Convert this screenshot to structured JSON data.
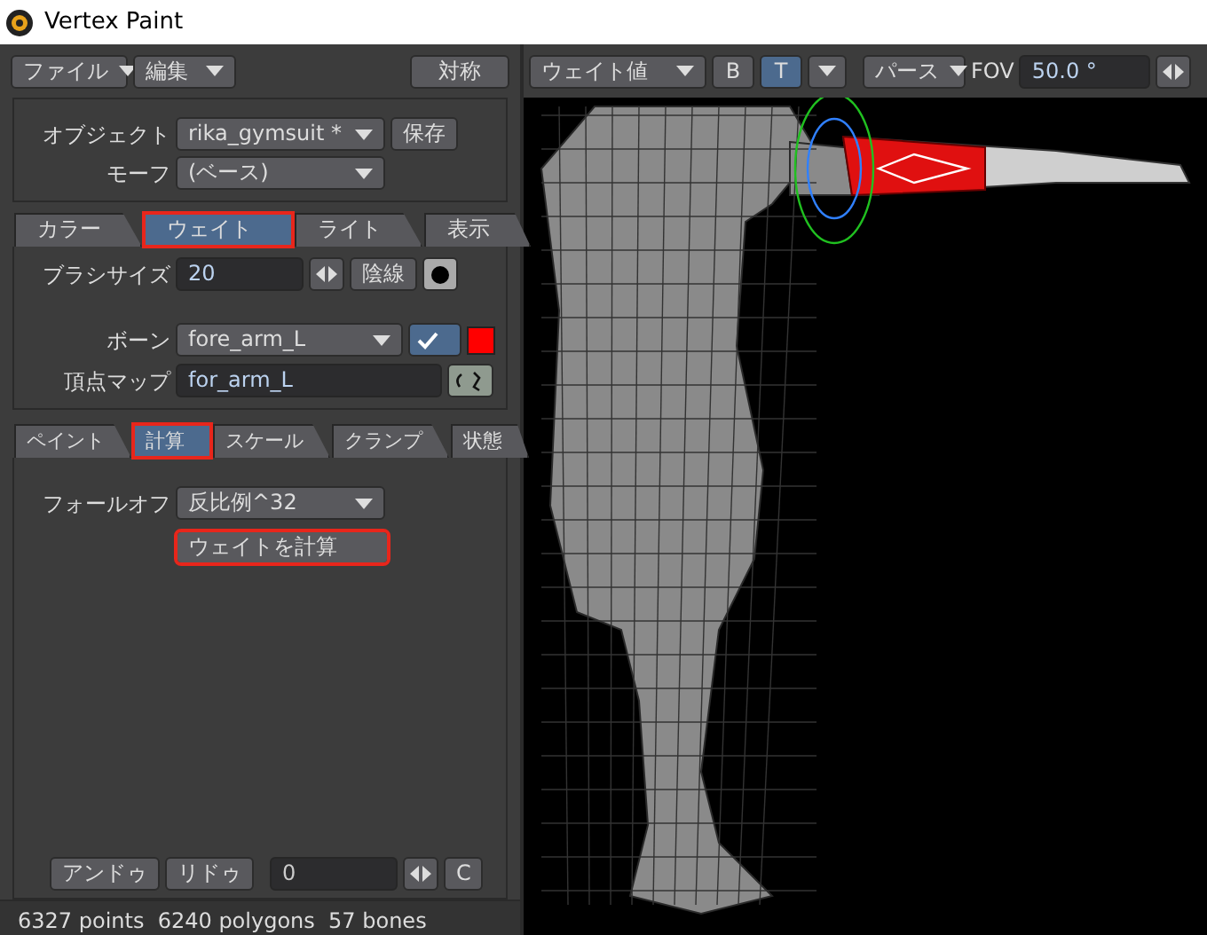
{
  "window": {
    "title": "Vertex Paint"
  },
  "menus": [
    {
      "label": "ファイル",
      "kind": "dropdown"
    },
    {
      "label": "編集",
      "kind": "dropdown"
    },
    {
      "label": "対称",
      "kind": "button"
    }
  ],
  "object_group": {
    "object_label": "オブジェクト",
    "object_value": "rika_gymsuit *",
    "save_button": "保存",
    "morph_label": "モーフ",
    "morph_value": "(ベース)"
  },
  "tabs": [
    {
      "label": "カラー",
      "selected": false,
      "highlighted": false
    },
    {
      "label": "ウェイト",
      "selected": true,
      "highlighted": true
    },
    {
      "label": "ライト",
      "selected": false,
      "highlighted": false
    },
    {
      "label": "表示",
      "selected": false,
      "highlighted": false
    }
  ],
  "brush": {
    "label": "ブラシサイズ",
    "value": "20",
    "hidden_line_button": "陰線"
  },
  "bone": {
    "label": "ボーン",
    "value": "fore_arm_L",
    "checked": true,
    "color": "#ff0000"
  },
  "vertex_map": {
    "label": "頂点マップ",
    "value": "for_arm_L"
  },
  "sub_tabs": [
    {
      "label": "ペイント",
      "selected": false,
      "highlighted": false
    },
    {
      "label": "計算",
      "selected": true,
      "highlighted": true
    },
    {
      "label": "スケール",
      "selected": false,
      "highlighted": false
    },
    {
      "label": "クランプ",
      "selected": false,
      "highlighted": false
    },
    {
      "label": "状態",
      "selected": false,
      "highlighted": false
    }
  ],
  "falloff": {
    "label": "フォールオフ",
    "value": "反比例^32"
  },
  "calc_button": {
    "label": "ウェイトを計算",
    "highlighted": true
  },
  "history": {
    "undo": "アンドゥ",
    "redo": "リドゥ",
    "value": "0",
    "clear": "C"
  },
  "status_bar": "6327 points  6240 polygons  57 bones",
  "viewport_toolbar": {
    "display_value": "ウェイト値",
    "toggles": [
      {
        "label": "B",
        "on": false
      },
      {
        "label": "T",
        "on": true
      }
    ],
    "projection": "パース",
    "fov_label": "FOV",
    "fov_value": "50.0 °"
  }
}
